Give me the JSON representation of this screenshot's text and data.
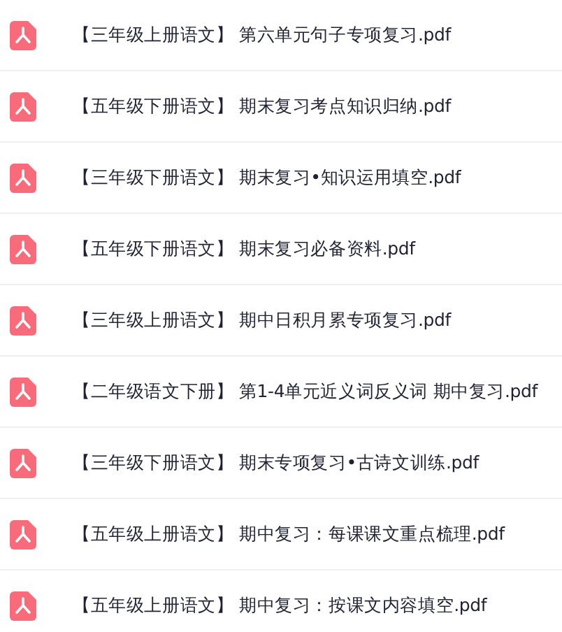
{
  "files": [
    {
      "name": "【三年级上册语文】 第六单元句子专项复习.pdf"
    },
    {
      "name": "【五年级下册语文】 期末复习考点知识归纳.pdf"
    },
    {
      "name": "【三年级下册语文】 期末复习•知识运用填空.pdf"
    },
    {
      "name": "【五年级下册语文】 期末复习必备资料.pdf"
    },
    {
      "name": "【三年级上册语文】 期中日积月累专项复习.pdf"
    },
    {
      "name": "【二年级语文下册】 第1-4单元近义词反义词 期中复习.pdf"
    },
    {
      "name": "【三年级下册语文】 期末专项复习•古诗文训练.pdf"
    },
    {
      "name": "【五年级上册语文】 期中复习：每课课文重点梳理.pdf"
    },
    {
      "name": "【五年级上册语文】 期中复习：按课文内容填空.pdf"
    }
  ]
}
